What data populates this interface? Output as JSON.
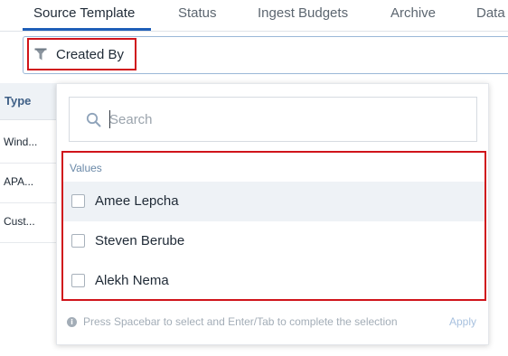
{
  "tabs": [
    {
      "label": "Source Template",
      "active": true
    },
    {
      "label": "Status",
      "active": false
    },
    {
      "label": "Ingest Budgets",
      "active": false
    },
    {
      "label": "Archive",
      "active": false
    },
    {
      "label": "Data",
      "active": false
    }
  ],
  "filter": {
    "chip_label": "Created By",
    "icon": "funnel-icon"
  },
  "table": {
    "column_header": "Type",
    "rows": [
      "Wind...",
      "APA...",
      "Cust..."
    ]
  },
  "dropdown": {
    "search_placeholder": "Search",
    "search_value": "",
    "values_label": "Values",
    "options": [
      {
        "label": "Amee Lepcha",
        "checked": false,
        "hovered": true
      },
      {
        "label": "Steven Berube",
        "checked": false,
        "hovered": false
      },
      {
        "label": "Alekh Nema",
        "checked": false,
        "hovered": false
      }
    ],
    "hint": "Press Spacebar to select and Enter/Tab to complete the selection",
    "apply_label": "Apply"
  },
  "colors": {
    "accent": "#1f5fb8",
    "highlight_annotation": "#d0141b",
    "hover_background": "#eef2f6",
    "muted_text": "#a3adb7"
  }
}
